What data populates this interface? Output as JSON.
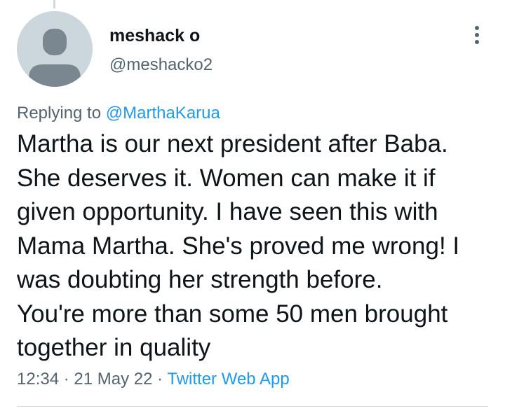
{
  "colors": {
    "accent": "#1d9bf0",
    "secondary_text": "#536471",
    "primary_text": "#0f1419",
    "avatar_bg": "#ccd6dd",
    "avatar_figure": "#7b8790"
  },
  "author": {
    "display_name": "meshack o",
    "handle": "@meshacko2",
    "avatar_icon": "default-profile-icon"
  },
  "more_icon": "more-vertical-icon",
  "reply_context": {
    "prefix": "Replying to ",
    "mention": "@MarthaKarua"
  },
  "tweet": {
    "lines": [
      "Martha is our next president after Baba.",
      "She deserves it. Women can make it if",
      "given opportunity. I have seen this with",
      "Mama Martha. She's proved me wrong! I",
      "was doubting her strength before.",
      "You're more than some 50 men brought",
      "together in quality"
    ]
  },
  "meta": {
    "time": "12:34",
    "separator": " · ",
    "date": "21 May 22",
    "source": "Twitter Web App"
  }
}
